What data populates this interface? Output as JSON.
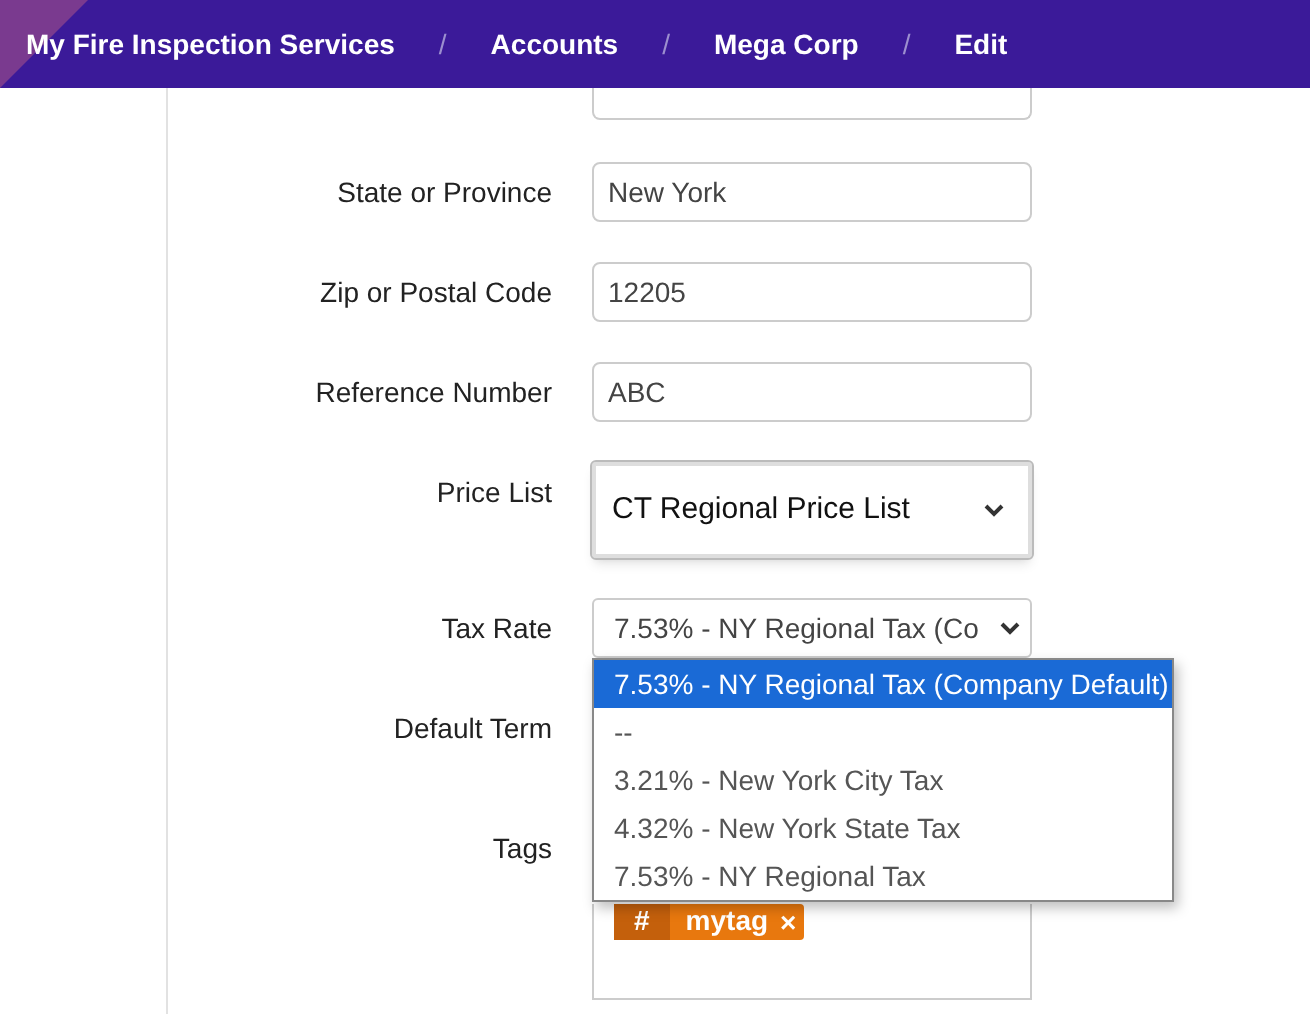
{
  "breadcrumbs": [
    {
      "kind": "link",
      "text": "My Fire Inspection Services"
    },
    {
      "kind": "separator",
      "text": "/"
    },
    {
      "kind": "link",
      "text": "Accounts"
    },
    {
      "kind": "separator",
      "text": "/"
    },
    {
      "kind": "link",
      "text": "Mega Corp"
    },
    {
      "kind": "separator",
      "text": "/"
    },
    {
      "kind": "link",
      "text": "Edit"
    }
  ],
  "fields": [
    {
      "kind": "input",
      "label": "State or Province",
      "value": "New York"
    },
    {
      "kind": "input",
      "label": "Zip or Postal Code",
      "value": "12205"
    },
    {
      "kind": "input",
      "label": "Reference Number",
      "value": "ABC"
    },
    {
      "kind": "large_select",
      "label": "Price List",
      "value": "CT Regional Price List"
    },
    {
      "kind": "select",
      "label": "Tax Rate",
      "value": "7.53% - NY Regional Tax (Co",
      "expanded": true,
      "options": [
        {
          "text": "7.53% - NY Regional Tax (Company Default)",
          "selected": true
        },
        {
          "text": "--",
          "selected": false
        },
        {
          "text": "3.21% - New York City Tax",
          "selected": false
        },
        {
          "text": "4.32% - New York State Tax",
          "selected": false
        },
        {
          "text": "7.53% - NY Regional Tax",
          "selected": false
        }
      ]
    },
    {
      "kind": "hidden",
      "label": "Default Term"
    },
    {
      "kind": "tags",
      "label": "Tags",
      "tags": [
        {
          "prefix": "#",
          "text": "mytag",
          "remove": "×"
        }
      ]
    }
  ]
}
